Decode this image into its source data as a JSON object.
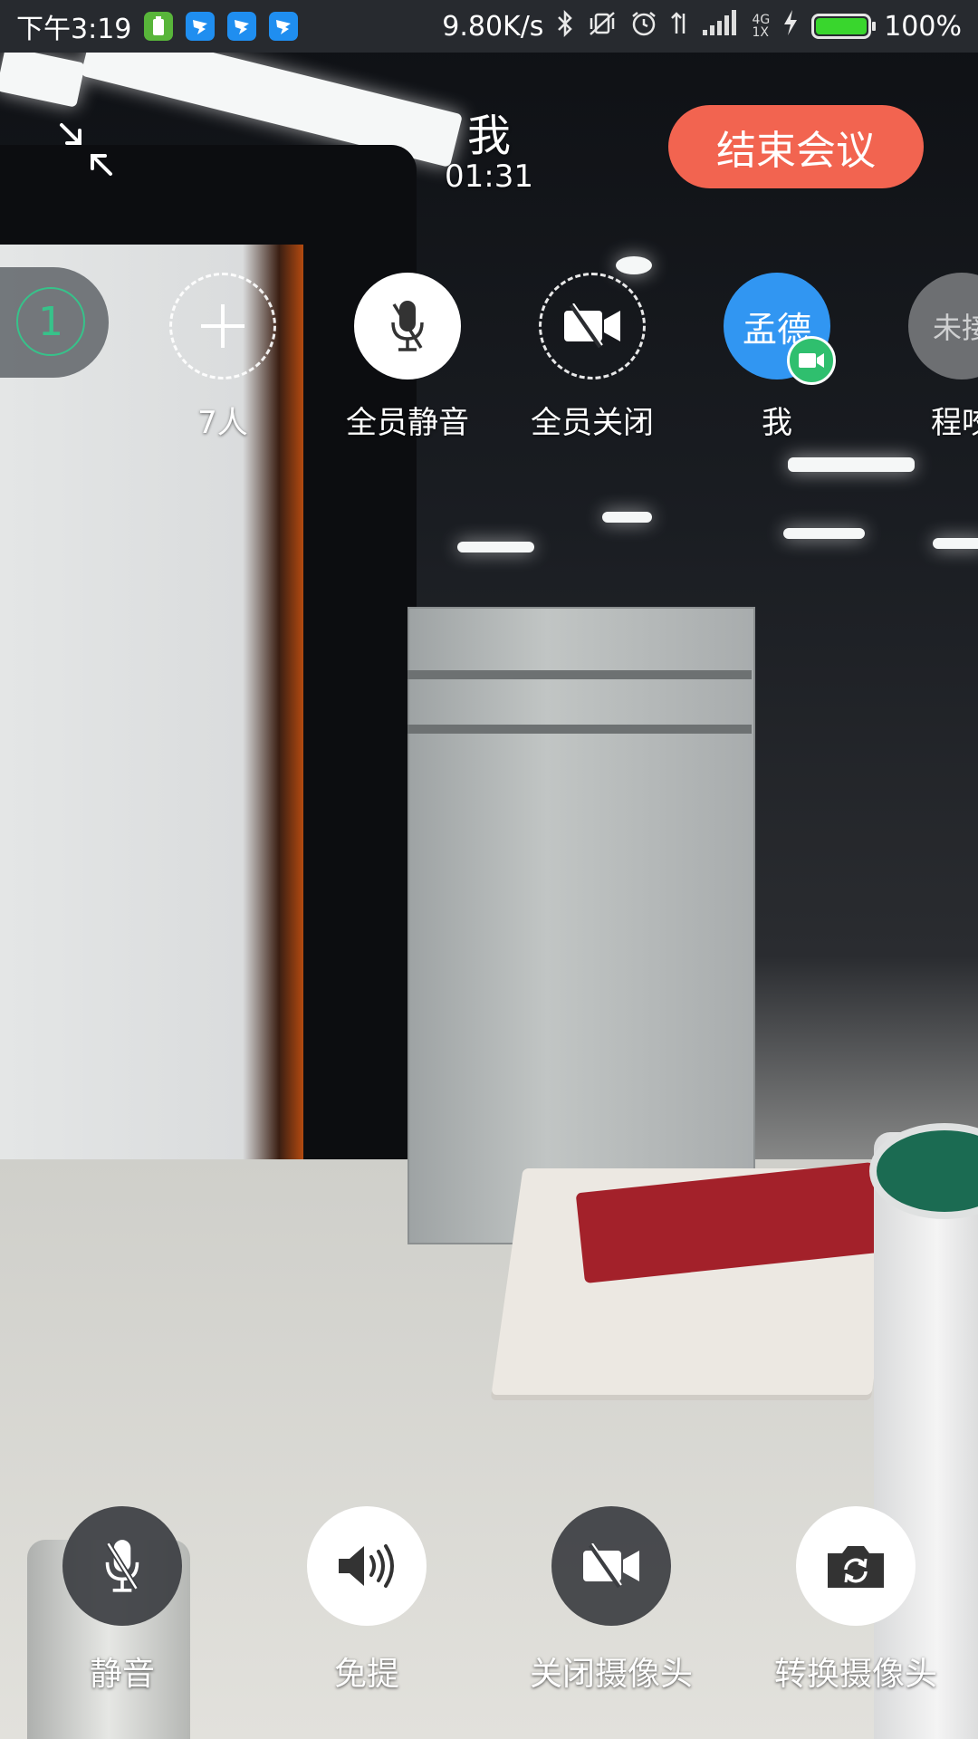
{
  "status_bar": {
    "time": "下午3:19",
    "net_speed": "9.80K/s",
    "net_type_top": "4G",
    "net_type_bottom": "1X",
    "battery_pct": "100%",
    "battery_level": 1.0,
    "icons": [
      "battery-app-icon",
      "dingtalk-icon",
      "dingtalk-icon",
      "dingtalk-icon",
      "bluetooth-icon",
      "vibrate-off-icon",
      "alarm-icon",
      "data-arrows-icon",
      "signal-icon",
      "charging-icon",
      "battery-icon"
    ]
  },
  "header": {
    "title": "我",
    "timer": "01:31",
    "end_meeting_label": "结束会议",
    "minimize_icon": "minimize-arrows-icon"
  },
  "participants_strip": {
    "count_badge": "1",
    "add_label": "7人",
    "mute_all_label": "全员静音",
    "close_all_label": "全员关闭",
    "self_avatar_text": "孟德",
    "self_label": "我",
    "other_avatar_text": "未接",
    "other_label": "程咬"
  },
  "controls": {
    "mute_label": "静音",
    "speaker_label": "免提",
    "camera_off_label": "关闭摄像头",
    "switch_camera_label": "转换摄像头"
  },
  "colors": {
    "end_button": "#f26450",
    "avatar_blue": "#3196f2",
    "video_badge": "#2fbf6e",
    "count_ring": "#37c28a",
    "status_bar_bg": "#272a2f"
  }
}
